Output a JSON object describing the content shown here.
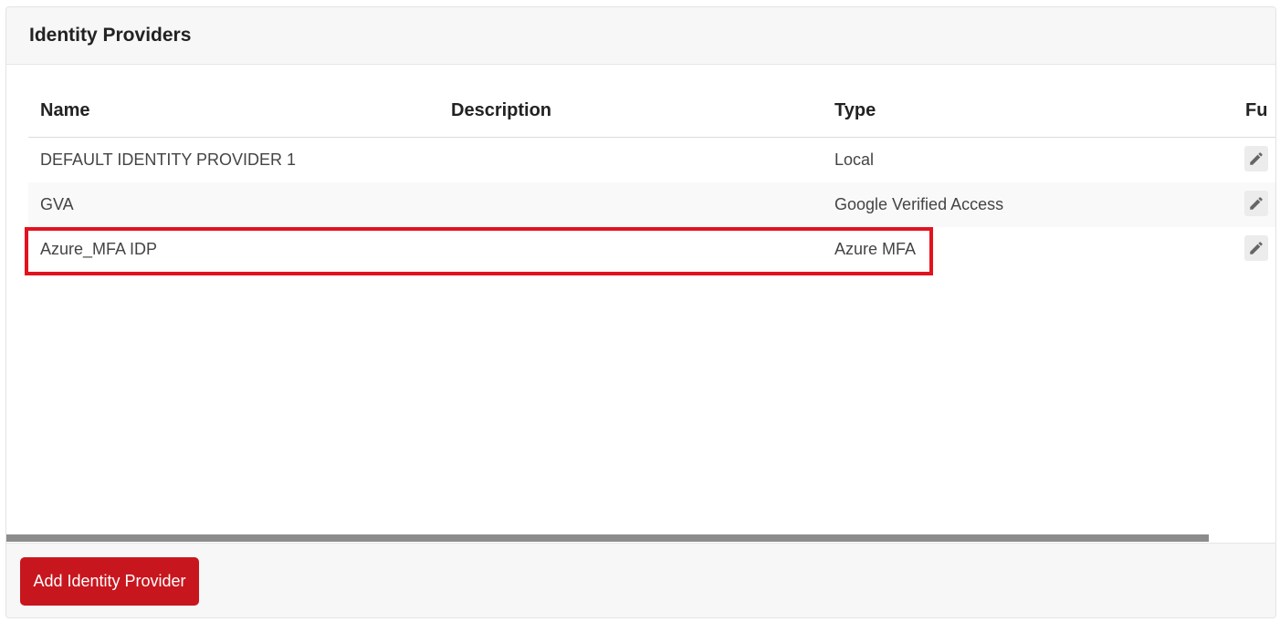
{
  "panel": {
    "title": "Identity Providers"
  },
  "table": {
    "columns": [
      "Name",
      "Description",
      "Type",
      "Fu"
    ],
    "rows": [
      {
        "name": "DEFAULT IDENTITY PROVIDER 1",
        "description": "",
        "type": "Local",
        "action_icon": "pencil-icon"
      },
      {
        "name": "GVA",
        "description": "",
        "type": "Google Verified Access",
        "action_icon": "pencil-icon"
      },
      {
        "name": "Azure_MFA IDP",
        "description": "",
        "type": "Azure MFA",
        "action_icon": "pencil-icon",
        "highlighted": true
      }
    ]
  },
  "footer": {
    "add_button_label": "Add Identity Provider"
  },
  "colors": {
    "accent": "#c8161e",
    "highlight_border": "#e3121f",
    "header_bg": "#f7f7f7",
    "scrollbar": "#8c8c8c"
  }
}
